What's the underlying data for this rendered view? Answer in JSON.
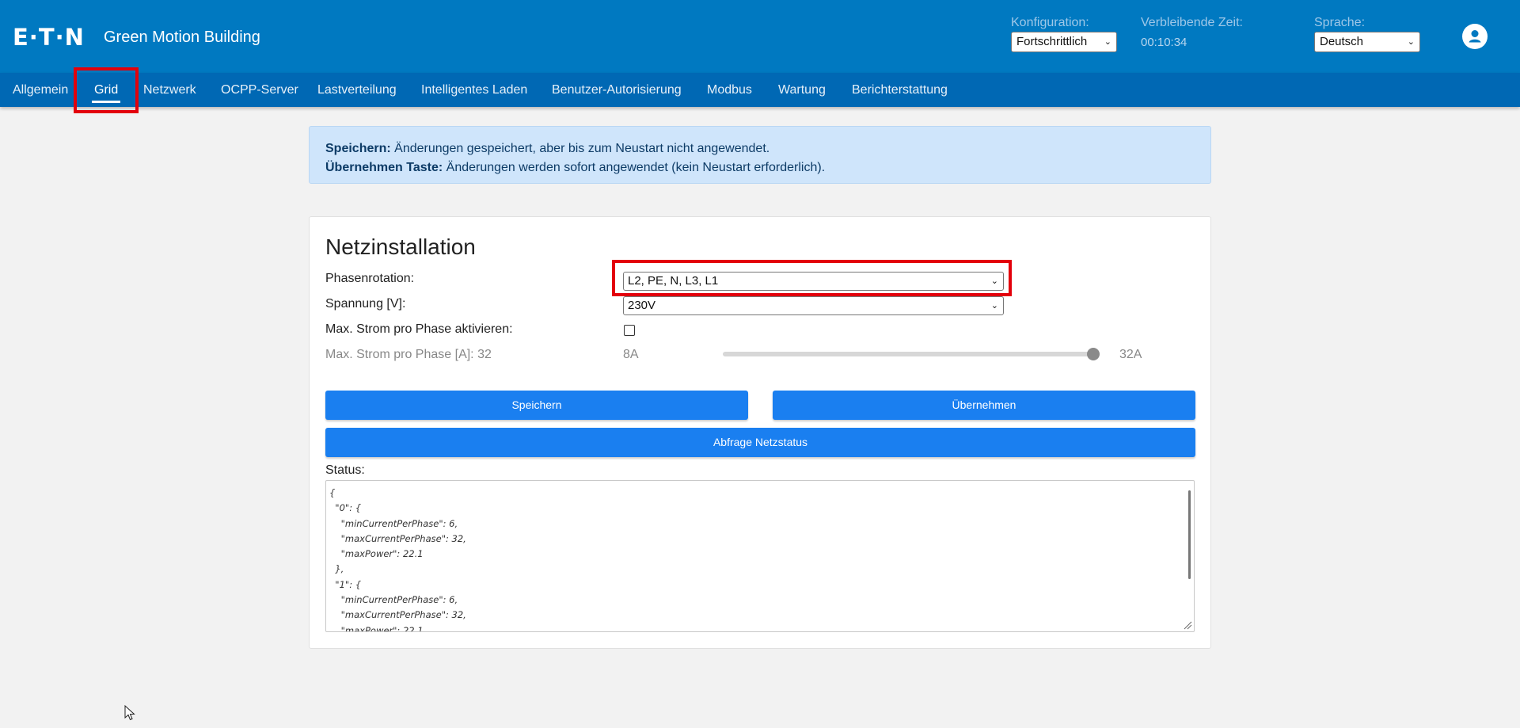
{
  "header": {
    "logo_text": "E·T·N",
    "app_title": "Green Motion Building",
    "config_label": "Konfiguration:",
    "config_value": "Fortschrittlich",
    "time_label": "Verbleibende Zeit:",
    "time_value": "00:10:34",
    "language_label": "Sprache:",
    "language_value": "Deutsch",
    "avatar_icon": "user-account-icon"
  },
  "nav": {
    "tabs": [
      {
        "label": "Allgemein"
      },
      {
        "label": "Grid",
        "active": true
      },
      {
        "label": "Netzwerk"
      },
      {
        "label": "OCPP-Server"
      },
      {
        "label": "Lastverteilung"
      },
      {
        "label": "Intelligentes Laden"
      },
      {
        "label": "Benutzer-Autorisierung"
      },
      {
        "label": "Modbus"
      },
      {
        "label": "Wartung"
      },
      {
        "label": "Berichterstattung"
      }
    ]
  },
  "info": {
    "save_title": "Speichern:",
    "save_text": "Änderungen gespeichert, aber bis zum Neustart nicht angewendet.",
    "apply_title": "Übernehmen Taste:",
    "apply_text": "Änderungen werden sofort angewendet (kein Neustart erforderlich)."
  },
  "form": {
    "title": "Netzinstallation",
    "phase_label": "Phasenrotation:",
    "phase_value": "L2, PE, N, L3, L1",
    "voltage_label": "Spannung [V]:",
    "voltage_value": "230V",
    "max_enable_label": "Max. Strom pro Phase aktivieren:",
    "max_enable_checked": false,
    "max_label": "Max. Strom pro Phase [A]: 32",
    "range_min": "8A",
    "range_max": "32A",
    "slider_min": 8,
    "slider_max": 32,
    "slider_value": 32,
    "save_button": "Speichern",
    "apply_button": "Übernehmen",
    "query_button": "Abfrage Netzstatus",
    "status_label": "Status:",
    "status_text": "{\n  \"0\": {\n    \"minCurrentPerPhase\": 6,\n    \"maxCurrentPerPhase\": 32,\n    \"maxPower\": 22.1\n  },\n  \"1\": {\n    \"minCurrentPerPhase\": 6,\n    \"maxCurrentPerPhase\": 32,\n    \"maxPower\": 22.1"
  },
  "colors": {
    "header_bg": "#0079c1",
    "nav_bg": "#0068b4",
    "button_bg": "#1a7ff0",
    "highlight": "#e3000b",
    "info_bg": "#cfe5fb"
  }
}
